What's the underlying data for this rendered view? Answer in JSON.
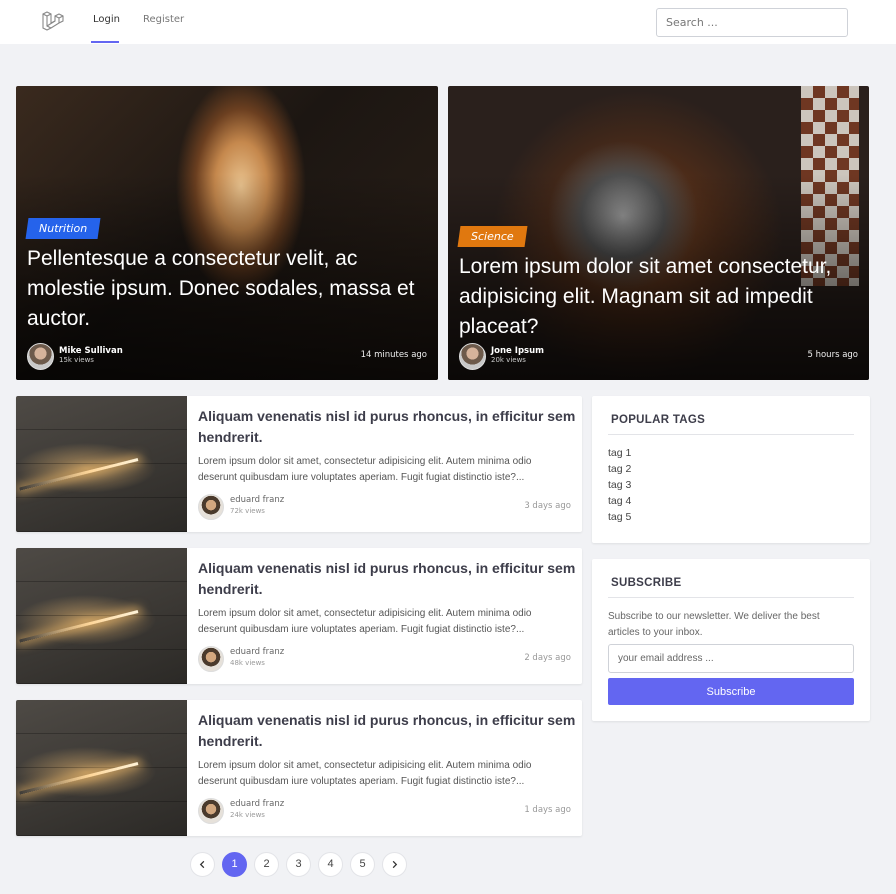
{
  "header": {
    "nav": {
      "login": "Login",
      "register": "Register"
    },
    "search_placeholder": "Search ..."
  },
  "featured": [
    {
      "category": "Nutrition",
      "category_color": "#2563eb",
      "title": "Pellentesque a consectetur velit, ac molestie ipsum. Donec sodales, massa et auctor.",
      "author": "Mike Sullivan",
      "views": "15k views",
      "time": "14 minutes ago"
    },
    {
      "category": "Science",
      "category_color": "#e0780f",
      "title": "Lorem ipsum dolor sit amet consectetur, adipisicing elit. Magnam sit ad impedit placeat?",
      "author": "Jone Ipsum",
      "views": "20k views",
      "time": "5 hours ago"
    }
  ],
  "posts": [
    {
      "title": "Aliquam venenatis nisl id purus rhoncus, in efficitur sem hendrerit.",
      "excerpt": "Lorem ipsum dolor sit amet, consectetur adipisicing elit. Autem minima odio deserunt quibusdam iure voluptates aperiam. Fugit fugiat distinctio iste?...",
      "author": "eduard franz",
      "views": "72k views",
      "time": "3 days ago"
    },
    {
      "title": "Aliquam venenatis nisl id purus rhoncus, in efficitur sem hendrerit.",
      "excerpt": "Lorem ipsum dolor sit amet, consectetur adipisicing elit. Autem minima odio deserunt quibusdam iure voluptates aperiam. Fugit fugiat distinctio iste?...",
      "author": "eduard franz",
      "views": "48k views",
      "time": "2 days ago"
    },
    {
      "title": "Aliquam venenatis nisl id purus rhoncus, in efficitur sem hendrerit.",
      "excerpt": "Lorem ipsum dolor sit amet, consectetur adipisicing elit. Autem minima odio deserunt quibusdam iure voluptates aperiam. Fugit fugiat distinctio iste?...",
      "author": "eduard franz",
      "views": "24k views",
      "time": "1 days ago"
    }
  ],
  "sidebar": {
    "tags_title": "POPULAR TAGS",
    "tags": [
      "tag 1",
      "tag 2",
      "tag 3",
      "tag 4",
      "tag 5"
    ],
    "subscribe": {
      "title": "SUBSCRIBE",
      "text": "Subscribe to our newsletter. We deliver the best articles to your inbox.",
      "email_placeholder": "your email address ...",
      "button": "Subscribe"
    }
  },
  "pagination": {
    "pages": [
      "1",
      "2",
      "3",
      "4",
      "5"
    ],
    "current": "1"
  },
  "accent_color": "#6366f1"
}
